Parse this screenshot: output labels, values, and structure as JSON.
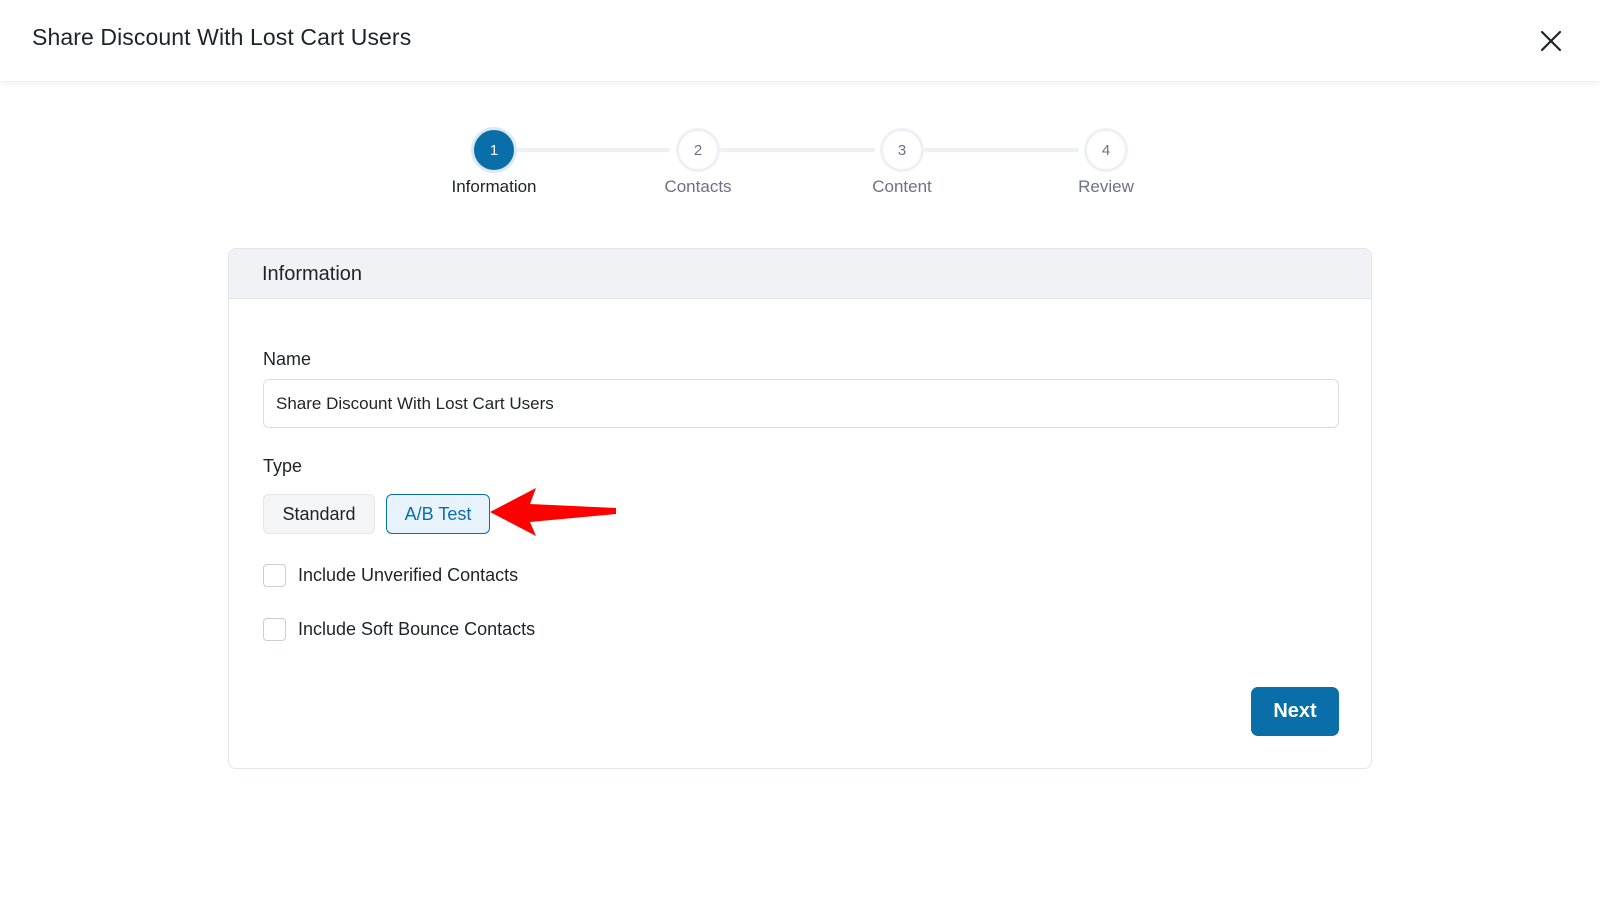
{
  "header": {
    "title": "Share Discount With Lost Cart Users"
  },
  "stepper": {
    "steps": [
      {
        "number": "1",
        "label": "Information",
        "active": true
      },
      {
        "number": "2",
        "label": "Contacts",
        "active": false
      },
      {
        "number": "3",
        "label": "Content",
        "active": false
      },
      {
        "number": "4",
        "label": "Review",
        "active": false
      }
    ]
  },
  "card": {
    "title": "Information",
    "name_label": "Name",
    "name_value": "Share Discount With Lost Cart Users",
    "type_label": "Type",
    "type_options": [
      "Standard",
      "A/B Test"
    ],
    "type_selected": "A/B Test",
    "checkboxes": [
      {
        "label": "Include Unverified Contacts",
        "checked": false
      },
      {
        "label": "Include Soft Bounce Contacts",
        "checked": false
      }
    ],
    "next_label": "Next"
  },
  "colors": {
    "accent": "#0a6fa8",
    "annotation_arrow": "#ff0000"
  },
  "icons": {
    "close": "close-icon",
    "annotation": "red-arrow-icon"
  }
}
